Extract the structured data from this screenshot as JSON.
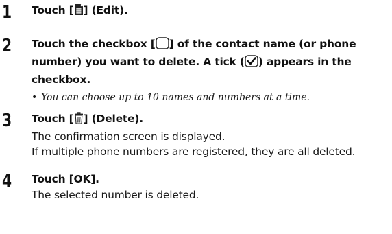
{
  "steps": [
    {
      "number": "1",
      "pre": "Touch [",
      "icon": "edit-icon",
      "post": "] (Edit)."
    },
    {
      "number": "2",
      "line1_pre": "Touch the checkbox [",
      "line1_icon": "checkbox-empty-icon",
      "line1_post": "] of the contact name (or phone",
      "line2_pre": "number) you want to delete. A tick (",
      "line2_icon": "checkbox-ticked-icon",
      "line2_post": ") appears in the",
      "line3": "checkbox.",
      "note": "You can choose up to 10 names and numbers at a time."
    },
    {
      "number": "3",
      "pre": "Touch [",
      "icon": "trash-icon",
      "post": "] (Delete).",
      "desc1": "The confirmation screen is displayed.",
      "desc2": "If multiple phone numbers are registered, they are all deleted."
    },
    {
      "number": "4",
      "label": "Touch [OK].",
      "desc1": "The selected number is deleted."
    }
  ],
  "bullet_glyph": "•"
}
